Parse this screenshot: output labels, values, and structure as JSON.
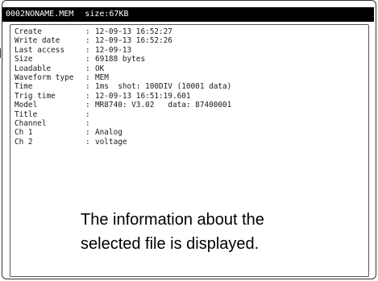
{
  "titlebar": {
    "filename": "0002NONAME.MEM",
    "size_text": "size:67KB"
  },
  "separator": ":",
  "info_rows": [
    {
      "label": "Create",
      "value": "12-09-13 16:52:27"
    },
    {
      "label": "Write date",
      "value": "12-09-13 16:52:26"
    },
    {
      "label": "Last access",
      "value": "12-09-13"
    },
    {
      "label": "Size",
      "value": "69188 bytes"
    },
    {
      "label": "Loadable",
      "value": "OK"
    },
    {
      "label": "Waveform type",
      "value": "MEM"
    },
    {
      "label": "Time",
      "value": "1ms  shot: 100DIV (10001 data)"
    },
    {
      "label": "Trig time",
      "value": "12-09-13 16:51:19.601"
    },
    {
      "label": "Model",
      "value": "MR8740: V3.02   data: 87400001"
    },
    {
      "label": "Title",
      "value": ""
    },
    {
      "label": "Channel",
      "value": ""
    },
    {
      "label": "Ch 1",
      "value": "Analog"
    },
    {
      "label": "Ch 2",
      "value": "voltage"
    }
  ],
  "caption": {
    "line1": "The information about the",
    "line2": "selected file is displayed."
  }
}
